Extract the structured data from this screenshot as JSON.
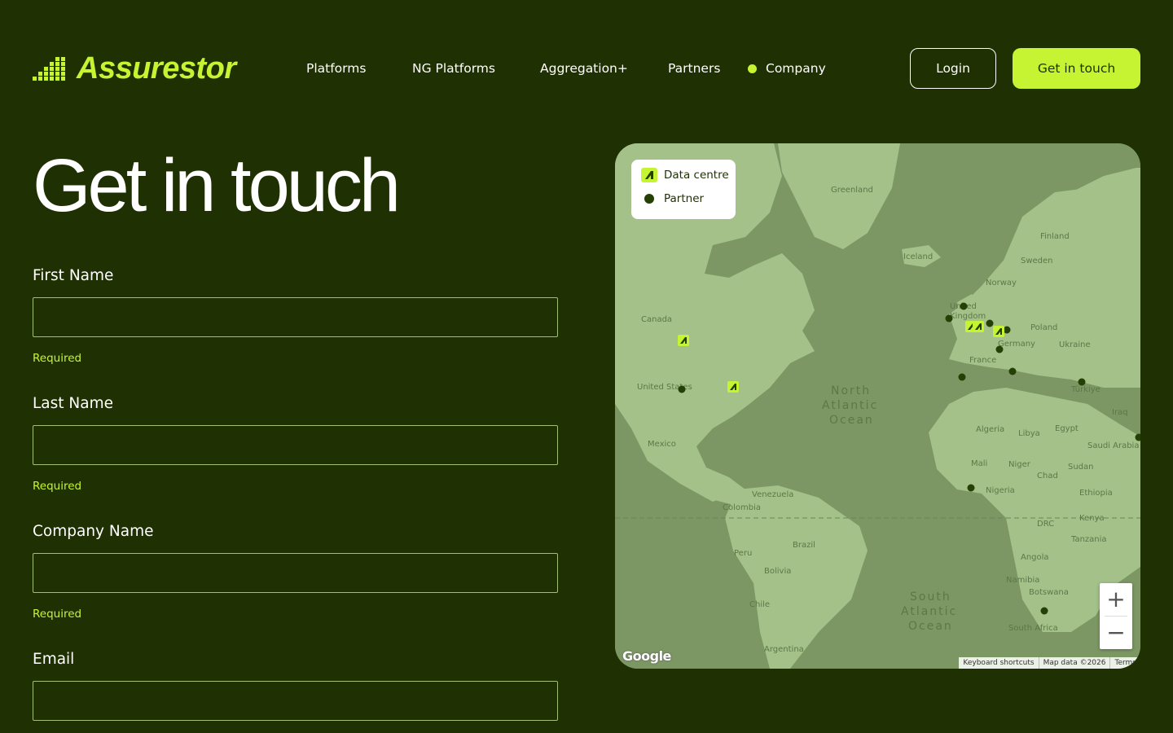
{
  "header": {
    "logo_text": "Assurestor",
    "nav": [
      {
        "label": "Platforms"
      },
      {
        "label": "NG Platforms"
      },
      {
        "label": "Aggregation+"
      },
      {
        "label": "Partners"
      },
      {
        "label": "Company",
        "active": true
      }
    ],
    "login_label": "Login",
    "cta_label": "Get in touch"
  },
  "page": {
    "title": "Get in touch"
  },
  "form": {
    "fields": [
      {
        "label": "First Name",
        "value": "",
        "help": "Required"
      },
      {
        "label": "Last Name",
        "value": "",
        "help": "Required"
      },
      {
        "label": "Company Name",
        "value": "",
        "help": "Required"
      },
      {
        "label": "Email",
        "value": ""
      }
    ]
  },
  "map": {
    "legend": {
      "data_centre": "Data centre",
      "partner": "Partner"
    },
    "labels": {
      "greenland": "Greenland",
      "iceland": "Iceland",
      "finland": "Finland",
      "sweden": "Sweden",
      "norway": "Norway",
      "uk_line1": "United",
      "uk_line2": "Kingdom",
      "poland": "Poland",
      "ukraine": "Ukraine",
      "germany": "Germany",
      "france": "France",
      "turkiye": "Türkiye",
      "iraq": "Iraq",
      "canada": "Canada",
      "united_states": "United States",
      "mexico": "Mexico",
      "north_atlantic_1": "North",
      "north_atlantic_2": "Atlantic",
      "north_atlantic_3": "Ocean",
      "algeria": "Algeria",
      "libya": "Libya",
      "egypt": "Egypt",
      "saudi_arabia": "Saudi Arabia",
      "mali": "Mali",
      "niger": "Niger",
      "chad": "Chad",
      "sudan": "Sudan",
      "nigeria": "Nigeria",
      "ethiopia": "Ethiopia",
      "venezuela": "Venezuela",
      "colombia": "Colombia",
      "drc": "DRC",
      "kenya": "Kenya",
      "tanzania": "Tanzania",
      "brazil": "Brazil",
      "peru": "Peru",
      "bolivia": "Bolivia",
      "angola": "Angola",
      "namibia": "Namibia",
      "botswana": "Botswana",
      "chile": "Chile",
      "south_atlantic_1": "South",
      "south_atlantic_2": "Atlantic",
      "south_atlantic_3": "Ocean",
      "south_africa": "South Africa",
      "argentina": "Argentina"
    },
    "zoom_in": "+",
    "zoom_out": "−",
    "google": "Google",
    "attribution": [
      "Keyboard shortcuts",
      "Map data ©2026",
      "Terms"
    ]
  },
  "colors": {
    "background": "#1f3002",
    "accent": "#c6f432",
    "ocean": "#7c9764",
    "land": "#a3c189",
    "marker": "#244004"
  }
}
